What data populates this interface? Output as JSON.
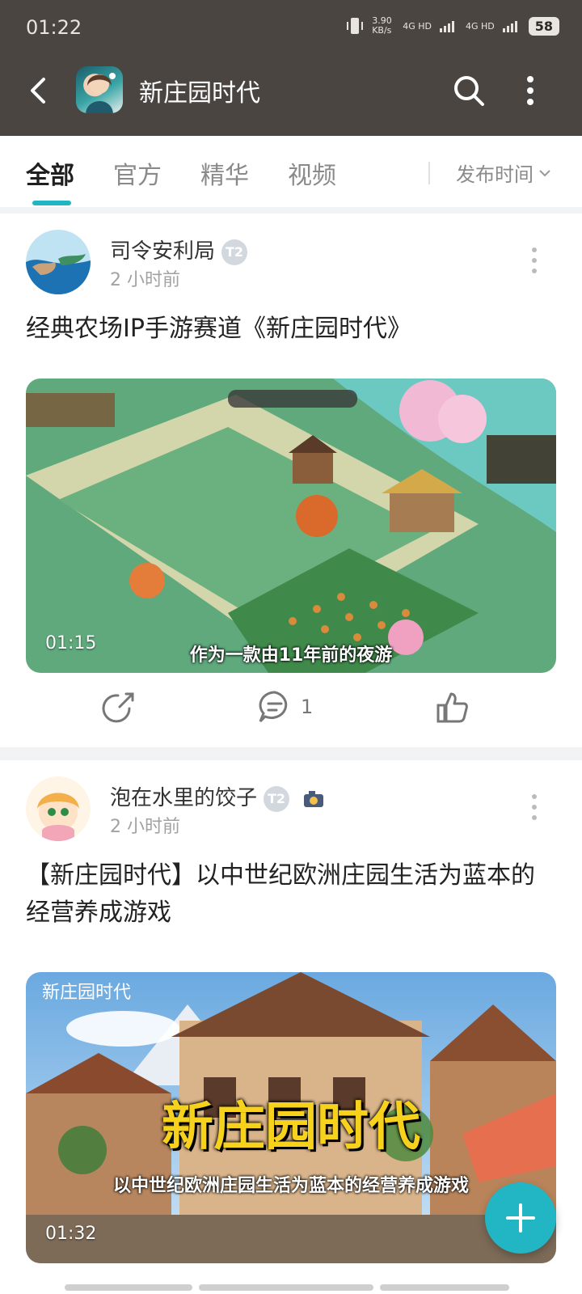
{
  "status_bar": {
    "time": "01:22",
    "network_speed": "3.90 KB/s",
    "signal_1": "4G HD",
    "signal_2": "4G HD",
    "battery": "58"
  },
  "header": {
    "title": "新庄园时代",
    "back_icon": "back-arrow-icon",
    "search_icon": "search-icon",
    "more_icon": "more-vertical-icon"
  },
  "tabs": {
    "items": [
      "全部",
      "官方",
      "精华",
      "视频"
    ],
    "active_index": 0,
    "sort_label": "发布时间"
  },
  "posts": [
    {
      "username": "司令安利局",
      "level_badge": "T2",
      "time": "2 小时前",
      "title": "经典农场IP手游赛道《新庄园时代》",
      "video_duration": "01:15",
      "video_subtitle": "作为一款由11年前的夜游",
      "comment_count": "1"
    },
    {
      "username": "泡在水里的饺子",
      "level_badge": "T2",
      "time": "2 小时前",
      "title": "【新庄园时代】以中世纪欧洲庄园生活为蓝本的经营养成游戏",
      "video_duration": "01:32",
      "video_overlay_title": "新庄园时代",
      "video_overlay_subtitle": "以中世纪欧洲庄园生活为蓝本的经营养成游戏",
      "video_watermark": "新庄园时代"
    }
  ],
  "colors": {
    "header_bg": "#4a4541",
    "accent": "#1fb6c5"
  }
}
